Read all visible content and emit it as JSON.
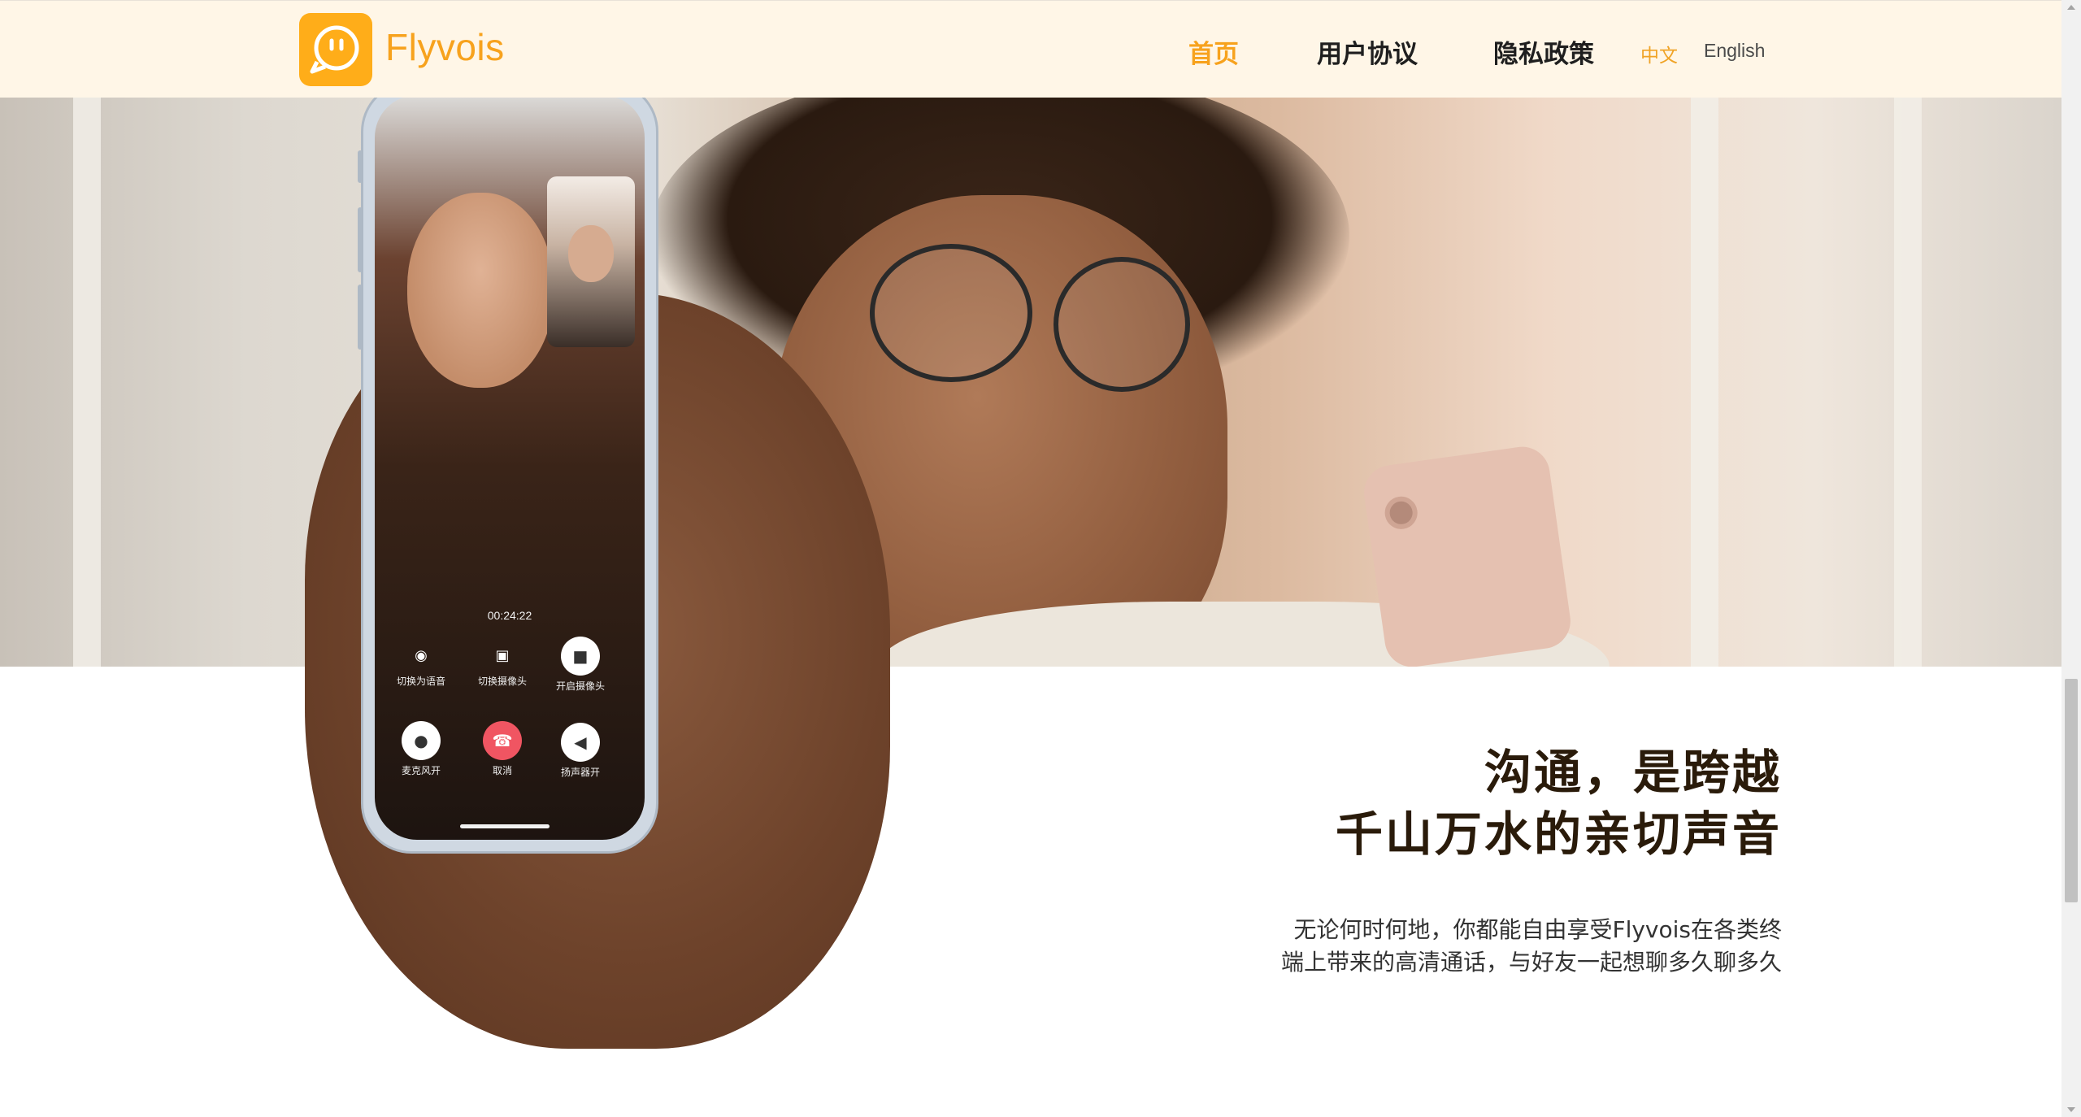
{
  "header": {
    "brand": "Flyvois",
    "nav": [
      {
        "label": "首页",
        "active": true
      },
      {
        "label": "用户协议",
        "active": false
      },
      {
        "label": "隐私政策",
        "active": false
      }
    ],
    "languages": [
      {
        "label": "中文",
        "active": true
      },
      {
        "label": "English",
        "active": false
      }
    ],
    "accent_color": "#f7a21d",
    "logo_icon": "chat-bubble-face-icon"
  },
  "phone_screen": {
    "call_timer": "00:24:22",
    "controls_top": [
      {
        "icon": "voice-wave-icon",
        "label": "切换为语音"
      },
      {
        "icon": "camera-switch-icon",
        "label": "切换摄像头"
      },
      {
        "icon": "video-camera-icon",
        "label": "开启摄像头"
      }
    ],
    "controls_bottom": [
      {
        "icon": "microphone-icon",
        "label": "麦克风开"
      },
      {
        "icon": "hang-up-icon",
        "label": "取消"
      },
      {
        "icon": "speaker-icon",
        "label": "扬声器开"
      }
    ]
  },
  "main": {
    "headline_line1": "沟通，是跨越",
    "headline_line2": "千山万水的亲切声音",
    "description_line1": "无论何时何地，你都能自由享受Flyvois在各类终",
    "description_line2": "端上带来的高清通话，与好友一起想聊多久聊多久"
  }
}
